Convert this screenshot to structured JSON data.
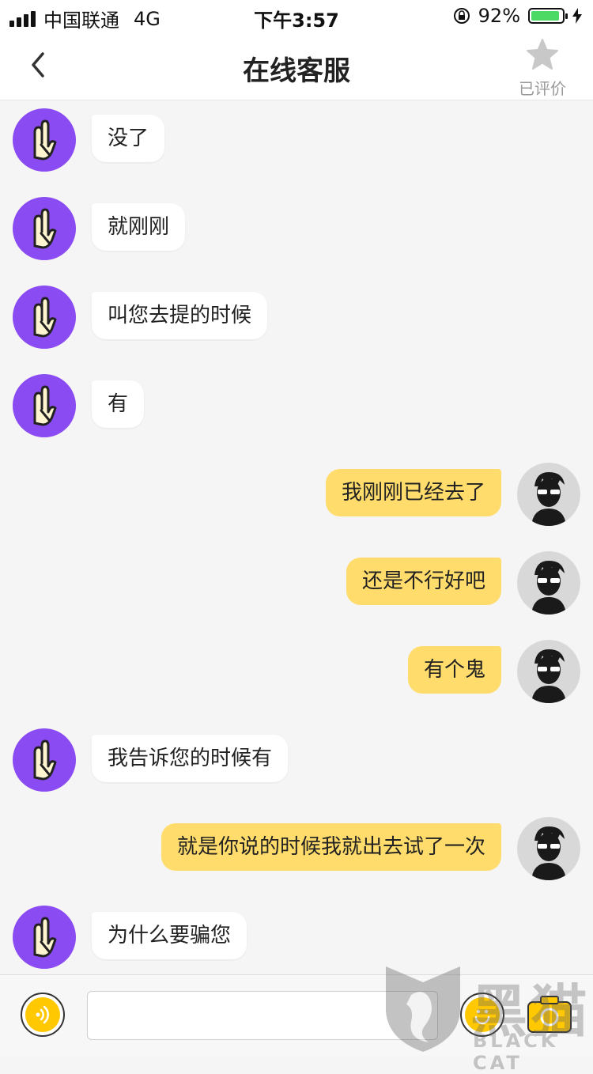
{
  "status_bar": {
    "carrier": "中国联通",
    "network": "4G",
    "time": "下午3:57",
    "battery_percent": "92%",
    "battery_level": 0.92
  },
  "nav": {
    "title": "在线客服",
    "rated_label": "已评价"
  },
  "messages": [
    {
      "side": "left",
      "text": "没了"
    },
    {
      "side": "left",
      "text": "就刚刚"
    },
    {
      "side": "left",
      "text": "叫您去提的时候"
    },
    {
      "side": "left",
      "text": "有"
    },
    {
      "side": "right",
      "text": "我刚刚已经去了"
    },
    {
      "side": "right",
      "text": "还是不行好吧"
    },
    {
      "side": "right",
      "text": "有个鬼"
    },
    {
      "side": "left",
      "text": "我告诉您的时候有"
    },
    {
      "side": "right",
      "text": "就是你说的时候我就出去试了一次"
    },
    {
      "side": "left",
      "text": "为什么要骗您"
    }
  ],
  "input": {
    "value": "",
    "placeholder": ""
  },
  "watermark": {
    "cn": "黑猫",
    "en": "BLACK CAT"
  },
  "colors": {
    "agent_avatar": "#8a4cf2",
    "user_bubble": "#ffdc6b",
    "accent_yellow": "#ffc800",
    "battery_green": "#4cd964"
  },
  "icons": {
    "back": "chevron-left-icon",
    "rate": "star-icon",
    "voice": "voice-icon",
    "emoji": "emoji-icon",
    "camera": "camera-icon",
    "agent_avatar": "rock-hand-icon",
    "user_avatar": "user-sunglasses-icon"
  }
}
